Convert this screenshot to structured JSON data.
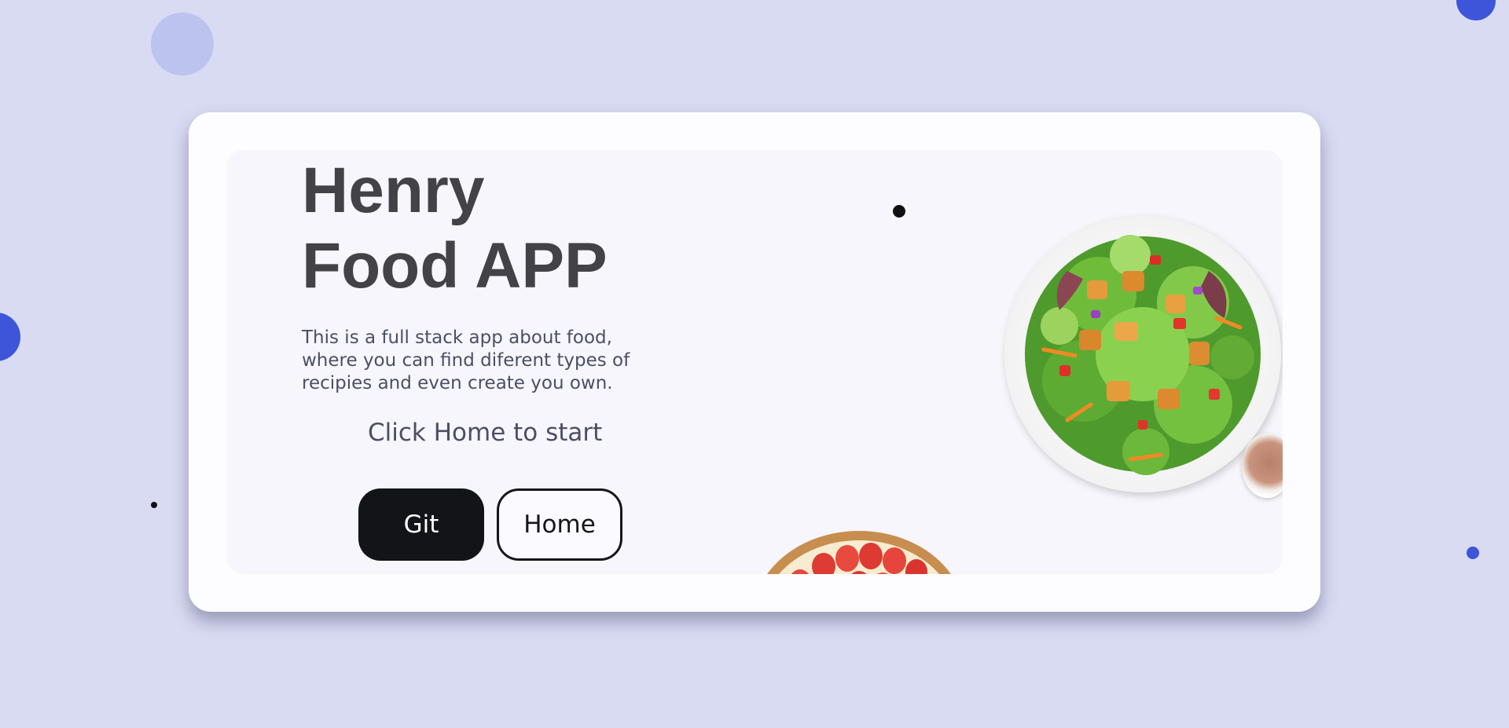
{
  "hero": {
    "title": "Henry\nFood APP",
    "description": "This is a full stack app about food, where you can find diferent types of recipies and even create you own.",
    "cta_text": "Click Home to start"
  },
  "buttons": {
    "git_label": "Git",
    "home_label": "Home"
  },
  "colors": {
    "background": "#d8dbf2",
    "accent_blue": "#3d55d8",
    "pale_circle": "#bcc3ee",
    "card": "#fdfdff",
    "card_inner": "#f6f6fc",
    "title_text": "#424247",
    "body_text": "#4a4f66",
    "git_button": "#131418"
  },
  "images": {
    "salad": "salad-plate-image",
    "pie": "strawberry-pie-image",
    "cup": "dressing-cup-image"
  }
}
